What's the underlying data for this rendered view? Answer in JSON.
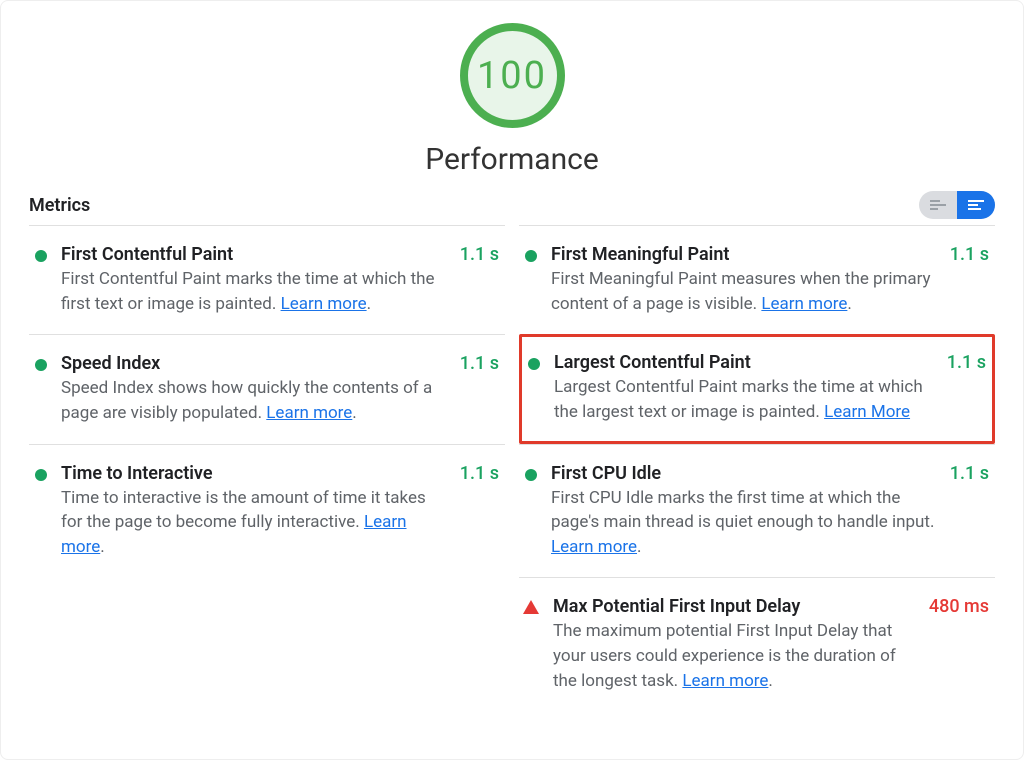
{
  "header": {
    "score": "100",
    "section_title": "Performance"
  },
  "metrics_header": {
    "label": "Metrics"
  },
  "learn_more": "Learn more",
  "learn_more_cap": "Learn More",
  "metrics": {
    "fcp": {
      "title": "First Contentful Paint",
      "desc": "First Contentful Paint marks the time at which the first text or image is painted. ",
      "value": "1.1 s",
      "status": "green"
    },
    "fmp": {
      "title": "First Meaningful Paint",
      "desc": "First Meaningful Paint measures when the primary content of a page is visible. ",
      "value": "1.1 s",
      "status": "green"
    },
    "si": {
      "title": "Speed Index",
      "desc": "Speed Index shows how quickly the contents of a page are visibly populated. ",
      "value": "1.1 s",
      "status": "green"
    },
    "lcp": {
      "title": "Largest Contentful Paint",
      "desc": "Largest Contentful Paint marks the time at which the largest text or image is painted. ",
      "value": "1.1 s",
      "status": "green"
    },
    "tti": {
      "title": "Time to Interactive",
      "desc": "Time to interactive is the amount of time it takes for the page to become fully interactive. ",
      "value": "1.1 s",
      "status": "green"
    },
    "fci": {
      "title": "First CPU Idle",
      "desc": "First CPU Idle marks the first time at which the page's main thread is quiet enough to handle input. ",
      "value": "1.1 s",
      "status": "green"
    },
    "mpfid": {
      "title": "Max Potential First Input Delay",
      "desc": "The maximum potential First Input Delay that your users could experience is the duration of the longest task. ",
      "value": "480 ms",
      "status": "red"
    }
  }
}
